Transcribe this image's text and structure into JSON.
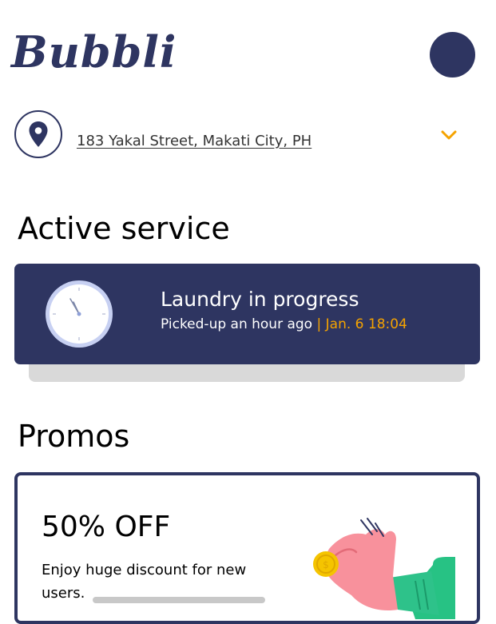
{
  "app": {
    "logo_text": "Bubbli"
  },
  "location": {
    "address": "183 Yakal Street, Makati City, PH"
  },
  "sections": {
    "active_service_heading": "Active service",
    "promos_heading": "Promos"
  },
  "active_service": {
    "title": "Laundry in progress",
    "status": "Picked-up an hour ago",
    "separator": "|",
    "timestamp": "Jan. 6 18:04"
  },
  "promo": {
    "title": "50% OFF",
    "description": "Enjoy huge discount for new users."
  },
  "colors": {
    "primary": "#2e3561",
    "accent": "#f5a300",
    "shadow": "#d9d9d9"
  },
  "icons": [
    "location-pin-icon",
    "chevron-down-icon",
    "clock-icon",
    "hand-coin-illustration"
  ]
}
